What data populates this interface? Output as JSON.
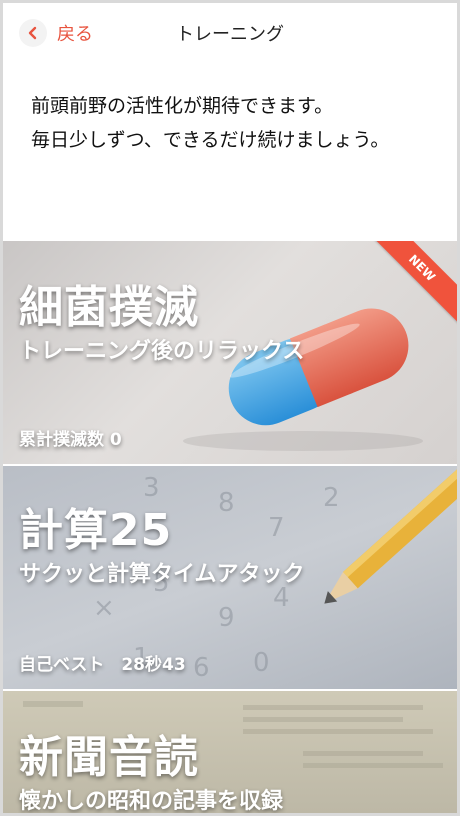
{
  "header": {
    "back_label": "戻る",
    "title": "トレーニング"
  },
  "intro": {
    "line1": "前頭前野の活性化が期待できます。",
    "line2": "毎日少しずつ、できるだけ続けましょう。"
  },
  "cards": [
    {
      "name": "細菌撲滅",
      "subtitle": "トレーニング後のリラックス",
      "stat": "累計撲滅数 0",
      "badge": "NEW",
      "icon": "capsule-pill-image"
    },
    {
      "name": "計算25",
      "subtitle": "サクッと計算タイムアタック",
      "stat": "自己ベスト　28秒43",
      "icon": "pencil-numbers-image"
    },
    {
      "name": "新聞音読",
      "subtitle": "懐かしの昭和の記事を収録",
      "icon": "newspaper-image"
    }
  ],
  "colors": {
    "accent": "#e8543f",
    "badge": "#f0533c"
  }
}
